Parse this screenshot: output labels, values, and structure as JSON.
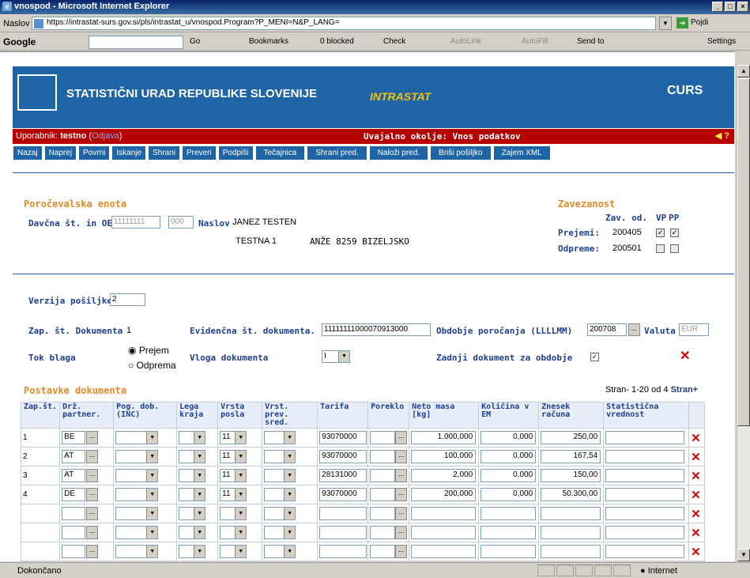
{
  "window": {
    "title": "vnospod - Microsoft Internet Explorer"
  },
  "address": {
    "label": "Naslov",
    "url": "https://intrastat-surs.gov.si/pls/intrastat_u/vnospod.Program?P_MENI=N&P_LANG=",
    "go": "Pojdi"
  },
  "googlebar": {
    "logo": "Google",
    "go": "Go",
    "bookmarks": "Bookmarks",
    "blocked": "0 blocked",
    "check": "Check",
    "autolink": "AutoLink",
    "autofill": "AutoFill",
    "sendto": "Send to",
    "settings": "Settings"
  },
  "banner": {
    "title": "STATISTIČNI URAD REPUBLIKE SLOVENIJE",
    "intrastat": "INTRASTAT",
    "curs": "CURS"
  },
  "userbar": {
    "label": "Uporabnik:",
    "user": "testno",
    "logout": "Odjava",
    "environment": "Uvajalno okolje: Vnos podatkov"
  },
  "nav": [
    "Nazaj",
    "Naprej",
    "Povrni",
    "Iskanje",
    "Shrani",
    "Preveri",
    "Podpiši",
    "Tečajnica",
    "Shrani pred.",
    "Naloži pred.",
    "Briši pošiljko",
    "Zajem XML"
  ],
  "reporting": {
    "heading": "Poročevalska enota",
    "tax_label": "Davčna št. in OE",
    "tax_no": "11111111",
    "oe": "000",
    "address_label": "Naslov",
    "name": "JANEZ TESTEN",
    "street": "TESTNA 1",
    "city": "ANŽE  8259  BIZELJSKO"
  },
  "obligation": {
    "heading": "Zavezanost",
    "col_from": "Zav. od.",
    "col_vp": "VP",
    "col_pp": "PP",
    "receipts_label": "Prejemi:",
    "receipts_from": "200405",
    "dispatches_label": "Odpreme:",
    "dispatches_from": "200501"
  },
  "shipment": {
    "version_label": "Verzija pošiljke",
    "version": "2",
    "doc_no_label": "Zap. št. Dokumenta",
    "doc_no": "1",
    "evid_label": "Evidenčna št. dokumenta.",
    "evid_no": "11111111000070913000",
    "period_label": "Obdobje poročanja (LLLLMM)",
    "period": "200708",
    "currency_label": "Valuta",
    "currency": "EUR",
    "flow_label": "Tok blaga",
    "flow_receipt": "Prejem",
    "flow_dispatch": "Odprema",
    "role_label": "Vloga dokumenta",
    "role_value": "I",
    "last_doc_label": "Zadnji dokument za obdobje"
  },
  "items": {
    "heading": "Postavke dokumenta",
    "paging": "Stran- 1-20 od 4",
    "next": "Stran+",
    "columns": [
      "Zap.št.",
      "Drž. partner.",
      "Pog. dob. (INC)",
      "Lega kraja",
      "Vrsta posla",
      "Vrst. prev. sred.",
      "Tarifa",
      "Poreklo",
      "Neto masa [kg]",
      "Količina v EM",
      "Znesek računa",
      "Statistična vrednost"
    ],
    "rows": [
      {
        "no": "1",
        "country": "BE",
        "type": "11",
        "tariff": "93070000",
        "net": "1.000,000",
        "qty": "0,000",
        "amount": "250,00"
      },
      {
        "no": "2",
        "country": "AT",
        "type": "11",
        "tariff": "93070000",
        "net": "100,000",
        "qty": "0,000",
        "amount": "167,54"
      },
      {
        "no": "3",
        "country": "AT",
        "type": "11",
        "tariff": "28131000",
        "net": "2,000",
        "qty": "0,000",
        "amount": "150,00"
      },
      {
        "no": "4",
        "country": "DE",
        "type": "11",
        "tariff": "93070000",
        "net": "200,000",
        "qty": "0,000",
        "amount": "50.300,00"
      },
      {
        "no": "",
        "country": "",
        "type": "",
        "tariff": "",
        "net": "",
        "qty": "",
        "amount": ""
      },
      {
        "no": "",
        "country": "",
        "type": "",
        "tariff": "",
        "net": "",
        "qty": "",
        "amount": ""
      },
      {
        "no": "",
        "country": "",
        "type": "",
        "tariff": "",
        "net": "",
        "qty": "",
        "amount": ""
      }
    ]
  },
  "status": {
    "text": "Dokončano",
    "zone": "Internet"
  }
}
